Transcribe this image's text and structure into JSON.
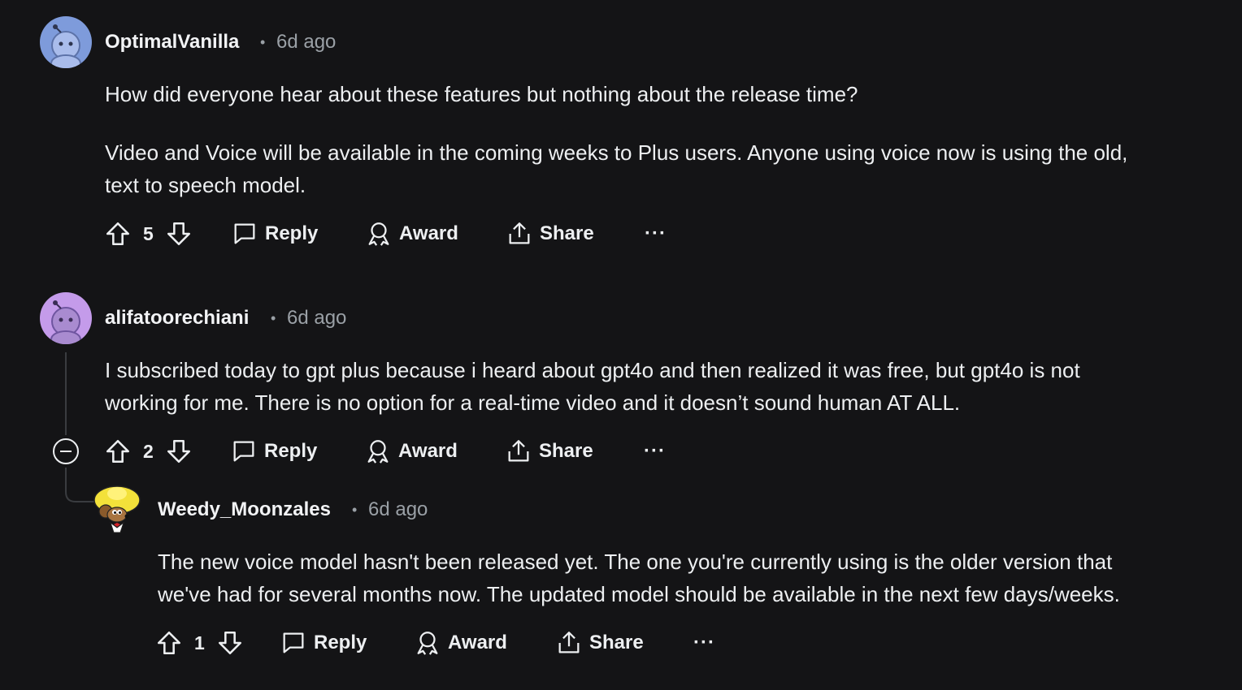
{
  "comments": [
    {
      "username": "OptimalVanilla",
      "time": "6d ago",
      "body_lines": [
        "How did everyone hear about these features but nothing about the release time?",
        "Video and Voice will be available in the coming weeks to Plus users. Anyone using voice now is using the old,",
        "text to speech model."
      ],
      "score": "5",
      "reply_label": "Reply",
      "award_label": "Award",
      "share_label": "Share",
      "avatar_color": "#7E9BDB"
    },
    {
      "username": "alifatoorechiani",
      "time": "6d ago",
      "body_lines": [
        "I subscribed today to gpt plus because i heard about gpt4o and then realized it was free, but gpt4o is not",
        "working for me. There is no option for a real-time video and it doesn’t sound human AT ALL."
      ],
      "score": "2",
      "reply_label": "Reply",
      "award_label": "Award",
      "share_label": "Share",
      "avatar_color": "#C49BEA"
    },
    {
      "username": "Weedy_Moonzales",
      "time": "6d ago",
      "body_lines": [
        "The new voice model hasn't been released yet. The one you're currently using is the older version that",
        "we've had for several months now. The updated model should be available in the next few days/weeks."
      ],
      "score": "1",
      "reply_label": "Reply",
      "award_label": "Award",
      "share_label": "Share",
      "avatar_color": "#F3E13A"
    }
  ]
}
